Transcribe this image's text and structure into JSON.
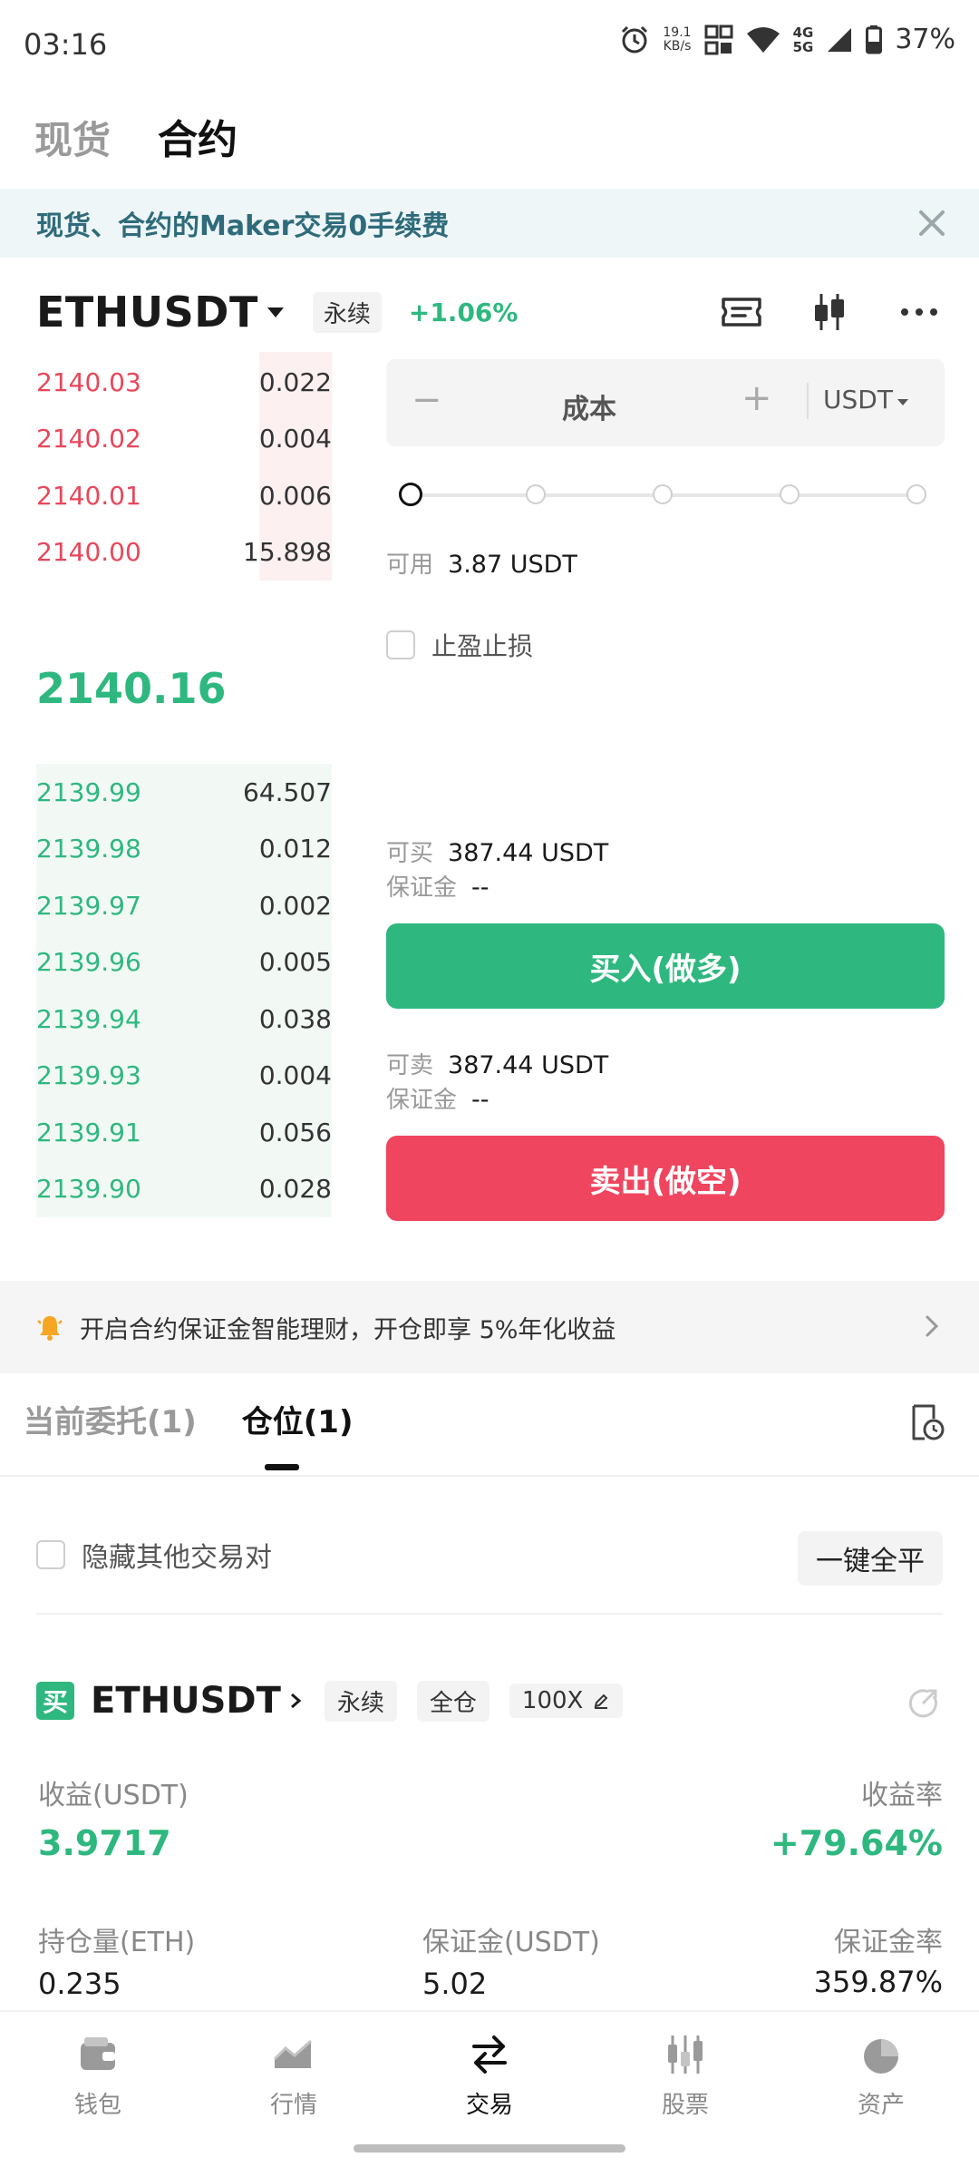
{
  "status_bar": {
    "time": "03:16",
    "speed_value": "19.1",
    "speed_unit": "KB/s",
    "net_top": "4G",
    "net_bottom": "5G",
    "battery": "37%"
  },
  "top_tabs": [
    {
      "label": "现货",
      "active": false
    },
    {
      "label": "合约",
      "active": true
    }
  ],
  "banner": {
    "text": "现货、合约的Maker交易0手续费"
  },
  "symbol": {
    "name": "ETHUSDT",
    "type_tag": "永续",
    "change": "+1.06%"
  },
  "order_book": {
    "asks": [
      {
        "price": "2140.03",
        "qty": "0.022",
        "depth": 0.08
      },
      {
        "price": "2140.02",
        "qty": "0.004",
        "depth": 0.08
      },
      {
        "price": "2140.01",
        "qty": "0.006",
        "depth": 0.08
      },
      {
        "price": "2140.00",
        "qty": "15.898",
        "depth": 0.16
      }
    ],
    "last_price": "2140.16",
    "bids": [
      {
        "price": "2139.99",
        "qty": "64.507"
      },
      {
        "price": "2139.98",
        "qty": "0.012"
      },
      {
        "price": "2139.97",
        "qty": "0.002"
      },
      {
        "price": "2139.96",
        "qty": "0.005"
      },
      {
        "price": "2139.94",
        "qty": "0.038"
      },
      {
        "price": "2139.93",
        "qty": "0.004"
      },
      {
        "price": "2139.91",
        "qty": "0.056"
      },
      {
        "price": "2139.90",
        "qty": "0.028"
      }
    ]
  },
  "form": {
    "minus": "−",
    "cost_label": "成本",
    "plus": "+",
    "unit": "USDT",
    "available_label": "可用",
    "available_value": "3.87 USDT",
    "tpsl_label": "止盈止损",
    "buy_max_label": "可买",
    "buy_max_value": "387.44 USDT",
    "buy_margin_label": "保证金",
    "buy_margin_value": "--",
    "buy_button": "买入(做多)",
    "sell_max_label": "可卖",
    "sell_max_value": "387.44 USDT",
    "sell_margin_label": "保证金",
    "sell_margin_value": "--",
    "sell_button": "卖出(做空)"
  },
  "earn_banner": {
    "text": "开启合约保证金智能理财，开仓即享 5%年化收益"
  },
  "position_tabs": [
    {
      "label": "当前委托(1)",
      "active": false
    },
    {
      "label": "仓位(1)",
      "active": true
    }
  ],
  "position_controls": {
    "hide_others": "隐藏其他交易对",
    "close_all": "一键全平"
  },
  "position": {
    "side_badge": "买",
    "symbol": "ETHUSDT",
    "tags": [
      "永续",
      "全仓",
      "100X"
    ],
    "pnl_label": "收益(USDT)",
    "pnl_value": "3.9717",
    "roe_label": "收益率",
    "roe_value": "+79.64%",
    "size_label": "持仓量(ETH)",
    "size_value": "0.235",
    "margin_label": "保证金(USDT)",
    "margin_value": "5.02",
    "margin_ratio_label": "保证金率",
    "margin_ratio_value": "359.87%"
  },
  "bottom_nav": [
    {
      "label": "钱包",
      "icon": "wallet-icon"
    },
    {
      "label": "行情",
      "icon": "chart-area-icon"
    },
    {
      "label": "交易",
      "icon": "swap-icon",
      "active": true
    },
    {
      "label": "股票",
      "icon": "candles-icon"
    },
    {
      "label": "资产",
      "icon": "pie-icon"
    }
  ],
  "colors": {
    "green": "#2eb87f",
    "red": "#f0455f",
    "ask_text": "#e8475b"
  }
}
